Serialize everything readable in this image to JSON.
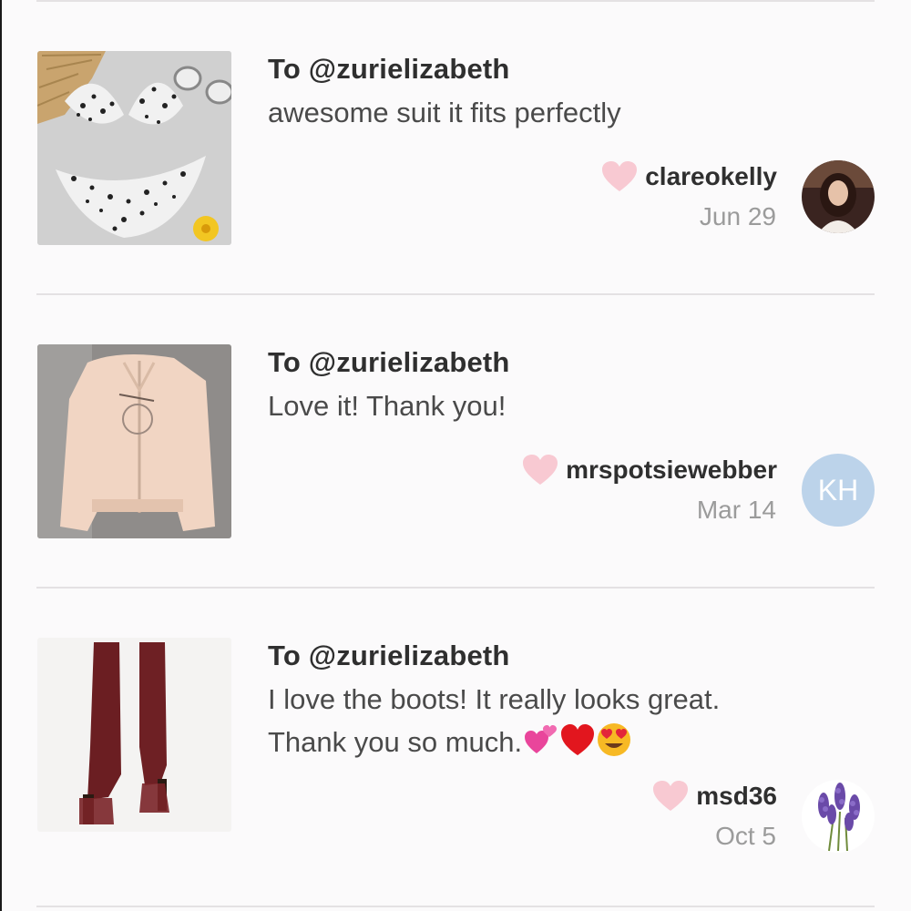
{
  "feedback": [
    {
      "to": "To @zurielizabeth",
      "message_lines": [
        "awesome suit it fits perfectly"
      ],
      "emojis": [],
      "username": "clareokelly",
      "date": "Jun 29",
      "product_icon": "leopard-bikini-image",
      "avatar_icon": "user-photo-avatar"
    },
    {
      "to": "To @zurielizabeth",
      "message_lines": [
        "Love it! Thank you!"
      ],
      "emojis": [],
      "username": "mrspotsiewebber",
      "date": "Mar 14",
      "product_icon": "peach-jacket-image",
      "avatar_initials": "KH"
    },
    {
      "to": "To @zurielizabeth",
      "message_lines": [
        "I love the boots! It really looks great.",
        "Thank you so much."
      ],
      "emojis": [
        "two-hearts-emoji",
        "red-heart-emoji",
        "heart-eyes-emoji"
      ],
      "username": "msd36",
      "date": "Oct 5",
      "product_icon": "red-boots-image",
      "avatar_icon": "lavender-avatar"
    }
  ],
  "colors": {
    "background": "#fbfafb",
    "divider": "#e4e1e3",
    "heart": "#f8c9d2",
    "date_text": "#9b9b9b",
    "initials_avatar": "#bcd3ea"
  }
}
